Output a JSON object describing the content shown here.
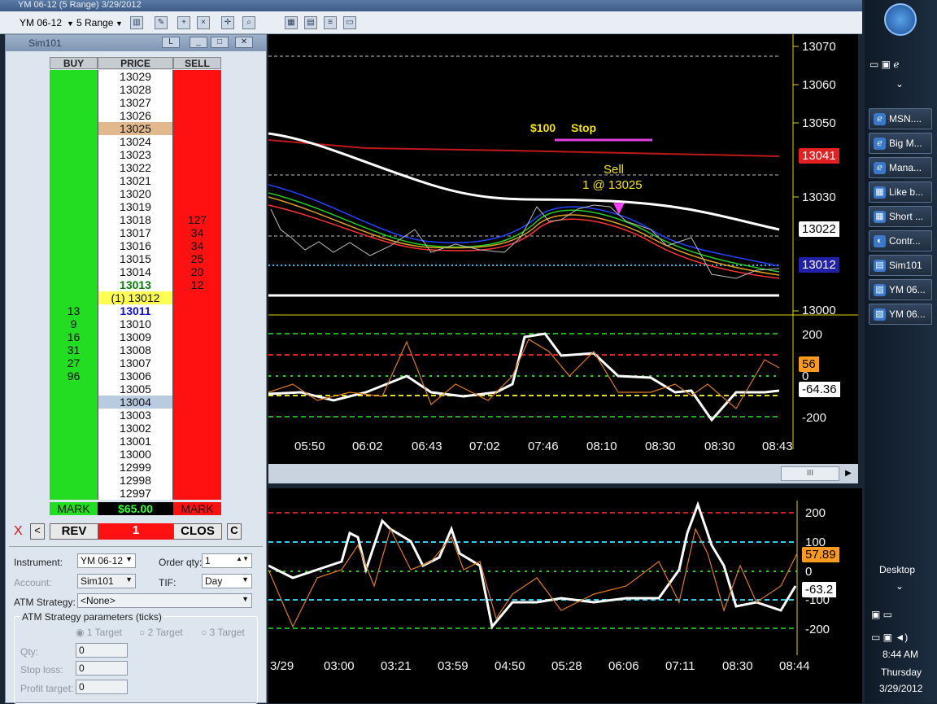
{
  "window": {
    "title": "YM 06-12 (5 Range)  3/29/2012"
  },
  "toolbar": {
    "instrument": "YM 06-12",
    "period": "5 Range"
  },
  "chart1": {
    "y_ticks": [
      "13070",
      "13060",
      "13050",
      "13030",
      "13000"
    ],
    "x_ticks": [
      "05:50",
      "06:02",
      "06:43",
      "07:02",
      "07:46",
      "08:10",
      "08:30",
      "08:30",
      "08:43"
    ],
    "annotations": {
      "stop_label": "$100",
      "stop_word": "Stop",
      "sell_label": "Sell",
      "sell_detail": "1 @ 13025"
    },
    "price_tags": {
      "red": "13041",
      "white": "13022",
      "blue": "13012"
    },
    "ind_ticks": [
      "200",
      "0",
      "-200"
    ],
    "ind_tags": {
      "orange": "56",
      "white": "-64.36"
    },
    "scroll_grip": "III"
  },
  "chart2": {
    "y_ticks": [
      "200",
      "100",
      "0",
      "-100",
      "-200"
    ],
    "x_ticks": [
      "3/29",
      "03:00",
      "03:21",
      "03:59",
      "04:50",
      "05:28",
      "06:06",
      "07:11",
      "08:30",
      "08:44"
    ],
    "tags": {
      "orange": "57.89",
      "white": "-63.2"
    }
  },
  "dom": {
    "title": "Sim101",
    "title_btn": "L",
    "headers": {
      "buy": "BUY",
      "price": "PRICE",
      "sell": "SELL"
    },
    "prices": [
      "13029",
      "13028",
      "13027",
      "13026",
      "13025",
      "13024",
      "13023",
      "13022",
      "13021",
      "13020",
      "13019",
      "13018",
      "13017",
      "13016",
      "13015",
      "13014",
      "13013",
      "(1) 13012",
      "13011",
      "13010",
      "13009",
      "13008",
      "13007",
      "13006",
      "13005",
      "13004",
      "13003",
      "13002",
      "13001",
      "13000",
      "12999",
      "12998",
      "12997"
    ],
    "buy_sizes": [
      "",
      "",
      "",
      "",
      "",
      "",
      "",
      "",
      "",
      "",
      "",
      "",
      "",
      "",
      "",
      "",
      "",
      "",
      "13",
      "9",
      "16",
      "31",
      "27",
      "96",
      "",
      "",
      "",
      "",
      "",
      "",
      "",
      "",
      ""
    ],
    "sell_sizes": [
      "",
      "",
      "",
      "",
      "",
      "",
      "",
      "",
      "",
      "",
      "",
      "127",
      "34",
      "34",
      "25",
      "20",
      "12",
      "",
      "",
      "",
      "",
      "",
      "",
      "",
      "",
      "",
      "",
      "",
      "",
      "",
      "",
      "",
      ""
    ],
    "footer": {
      "buy": "MARK",
      "pnl": "$65.00",
      "sell": "MARK"
    },
    "actions": {
      "x": "X",
      "left": "<",
      "rev": "REV",
      "qty": "1",
      "close": "CLOS",
      "c": "C"
    },
    "form": {
      "instrument_label": "Instrument:",
      "instrument_value": "YM 06-12",
      "order_qty_label": "Order qty:",
      "order_qty_value": "1",
      "account_label": "Account:",
      "account_value": "Sim101",
      "tif_label": "TIF:",
      "tif_value": "Day",
      "atm_label": "ATM Strategy:",
      "atm_value": "<None>",
      "params_label": "ATM Strategy parameters (ticks)",
      "targets": [
        "1 Target",
        "2 Target",
        "3 Target"
      ],
      "qty_label": "Qty:",
      "qty_value": "0",
      "stop_label": "Stop loss:",
      "stop_value": "0",
      "profit_label": "Profit target:",
      "profit_value": "0"
    }
  },
  "taskbar": {
    "items": [
      "MSN....",
      "Big M...",
      "Mana...",
      "Like b...",
      "Short ...",
      "Contr...",
      "Sim101",
      "YM 06...",
      "YM 06..."
    ],
    "desktop": "Desktop",
    "time": "8:44 AM",
    "day": "Thursday",
    "date": "3/29/2012"
  },
  "colors": {
    "buy": "#22dd22",
    "sell": "#ff1111",
    "accent": "#f5e400"
  }
}
